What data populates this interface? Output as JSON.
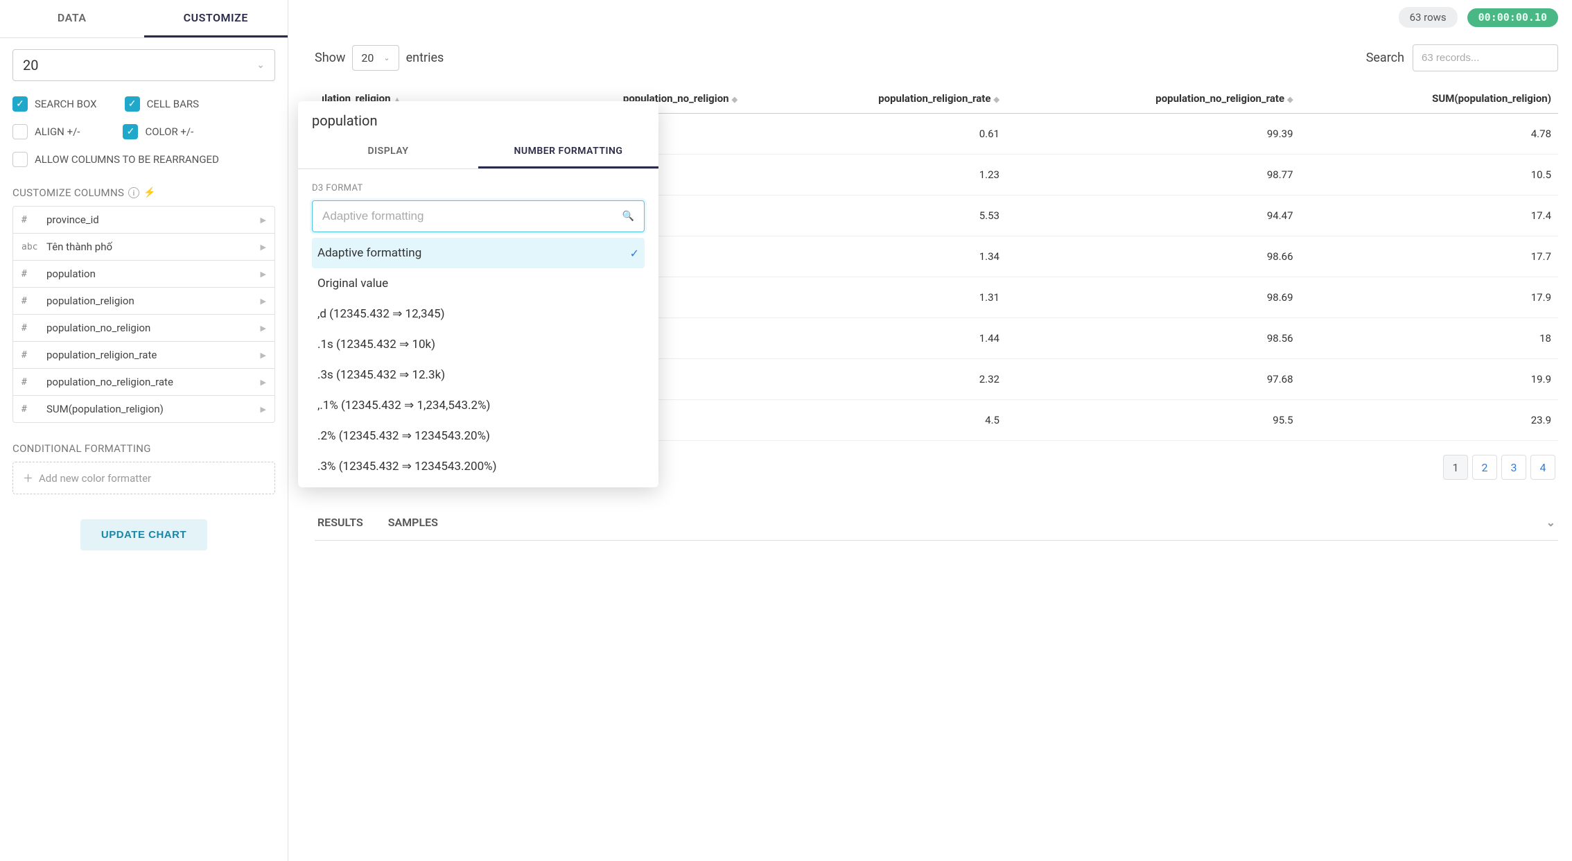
{
  "sidebar": {
    "tabs": {
      "data": "DATA",
      "customize": "CUSTOMIZE"
    },
    "page_select_value": "20",
    "checks": {
      "search_box": "SEARCH BOX",
      "cell_bars": "CELL BARS",
      "align_pm": "ALIGN +/-",
      "color_pm": "COLOR +/-",
      "allow_rearrange": "ALLOW COLUMNS TO BE REARRANGED"
    },
    "customize_columns_label": "CUSTOMIZE COLUMNS",
    "columns": [
      {
        "type": "#",
        "name": "province_id"
      },
      {
        "type": "abc",
        "name": "Tên thành phố"
      },
      {
        "type": "#",
        "name": "population"
      },
      {
        "type": "#",
        "name": "population_religion"
      },
      {
        "type": "#",
        "name": "population_no_religion"
      },
      {
        "type": "#",
        "name": "population_religion_rate"
      },
      {
        "type": "#",
        "name": "population_no_religion_rate"
      },
      {
        "type": "#",
        "name": "SUM(population_religion)"
      }
    ],
    "conditional_label": "CONDITIONAL FORMATTING",
    "add_formatter": "Add new color formatter",
    "update_btn": "UPDATE CHART"
  },
  "topbar": {
    "rows_badge": "63 rows",
    "time_badge": "00:00:00.10"
  },
  "controls": {
    "show_label": "Show",
    "show_value": "20",
    "entries_label": "entries",
    "search_label": "Search",
    "search_placeholder": "63 records..."
  },
  "table": {
    "headers": [
      "ılation_religion",
      "population_no_religion",
      "population_religion_rate",
      "population_no_religion_rate",
      "SUM(population_religion)"
    ],
    "rows": [
      {
        "c2": "0.61",
        "c3": "99.39",
        "c4": "4.78"
      },
      {
        "c2": "1.23",
        "c3": "98.77",
        "c4": "10.5"
      },
      {
        "c2": "5.53",
        "c3": "94.47",
        "c4": "17.4"
      },
      {
        "c2": "1.34",
        "c3": "98.66",
        "c4": "17.7"
      },
      {
        "c2": "1.31",
        "c3": "98.69",
        "c4": "17.9"
      },
      {
        "c2": "1.44",
        "c3": "98.56",
        "c4": "18"
      },
      {
        "c2": "2.32",
        "c3": "97.68",
        "c4": "19.9"
      },
      {
        "c2": "4.5",
        "c3": "95.5",
        "c4": "23.9"
      }
    ]
  },
  "popover": {
    "title": "population",
    "tabs": {
      "display": "DISPLAY",
      "number": "NUMBER FORMATTING"
    },
    "d3_label": "D3 FORMAT",
    "placeholder": "Adaptive formatting",
    "options": [
      "Adaptive formatting",
      "Original value",
      ",d (12345.432 ⇒ 12,345)",
      ".1s (12345.432 ⇒ 10k)",
      ".3s (12345.432 ⇒ 12.3k)",
      ",.1% (12345.432 ⇒ 1,234,543.2%)",
      ".2% (12345.432 ⇒ 1234543.20%)",
      ".3% (12345.432 ⇒ 1234543.200%)"
    ]
  },
  "pagination": [
    "1",
    "2",
    "3",
    "4"
  ],
  "footer": {
    "results": "RESULTS",
    "samples": "SAMPLES"
  }
}
